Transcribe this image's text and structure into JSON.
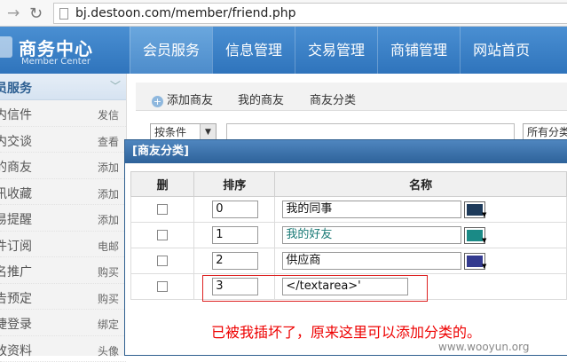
{
  "browser": {
    "url": "bj.destoon.com/member/friend.php"
  },
  "header": {
    "logo_title": "商务中心",
    "logo_sub": "Member Center",
    "menu": [
      {
        "label": "会员服务",
        "active": true
      },
      {
        "label": "信息管理"
      },
      {
        "label": "交易管理"
      },
      {
        "label": "商铺管理"
      },
      {
        "label": "网站首页"
      }
    ]
  },
  "sidebar": {
    "section": "员服务",
    "items": [
      {
        "label": "内信件",
        "action": "发信"
      },
      {
        "label": "内交谈",
        "action": "查看"
      },
      {
        "label": "的商友",
        "action": "添加"
      },
      {
        "label": "讯收藏",
        "action": "添加"
      },
      {
        "label": "易提醒",
        "action": "添加"
      },
      {
        "label": "件订阅",
        "action": "电邮"
      },
      {
        "label": "名推广",
        "action": "购买"
      },
      {
        "label": "告预定",
        "action": "购买"
      },
      {
        "label": "捷登录",
        "action": "绑定"
      },
      {
        "label": "改资料",
        "action": "头像"
      }
    ]
  },
  "tabs": {
    "add": "添加商友",
    "mine": "我的商友",
    "category": "商友分类"
  },
  "filter": {
    "condition": "按条件",
    "all_categories": "所有分类"
  },
  "dialog": {
    "title": "[商友分类]",
    "headers": {
      "del": "删",
      "order": "排序",
      "name": "名称"
    },
    "rows": [
      {
        "order": "0",
        "name": "我的同事",
        "color": "#1d3a5a"
      },
      {
        "order": "1",
        "name": "我的好友",
        "color": "#1a8a86"
      },
      {
        "order": "2",
        "name": "供应商",
        "color": "#333a8f"
      },
      {
        "order": "3",
        "name": "</textarea>'"
      }
    ]
  },
  "note": "已被我插坏了，原来这里可以添加分类的。",
  "watermark": "www.wooyun.org"
}
